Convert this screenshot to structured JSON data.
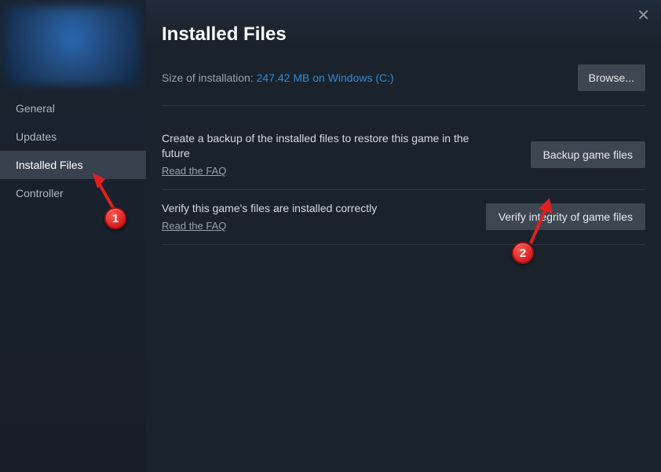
{
  "page_title": "Installed Files",
  "sidebar": {
    "items": [
      {
        "label": "General"
      },
      {
        "label": "Updates"
      },
      {
        "label": "Installed Files"
      },
      {
        "label": "Controller"
      }
    ],
    "active_index": 2
  },
  "size": {
    "prefix": "Size of installation: ",
    "value": "247.42 MB on Windows (C:)",
    "browse_label": "Browse..."
  },
  "backup": {
    "desc": "Create a backup of the installed files to restore this game in the future",
    "faq": "Read the FAQ",
    "button": "Backup game files"
  },
  "verify": {
    "desc": "Verify this game's files are installed correctly",
    "faq": "Read the FAQ",
    "button": "Verify integrity of game files"
  },
  "markers": {
    "one": "1",
    "two": "2"
  }
}
